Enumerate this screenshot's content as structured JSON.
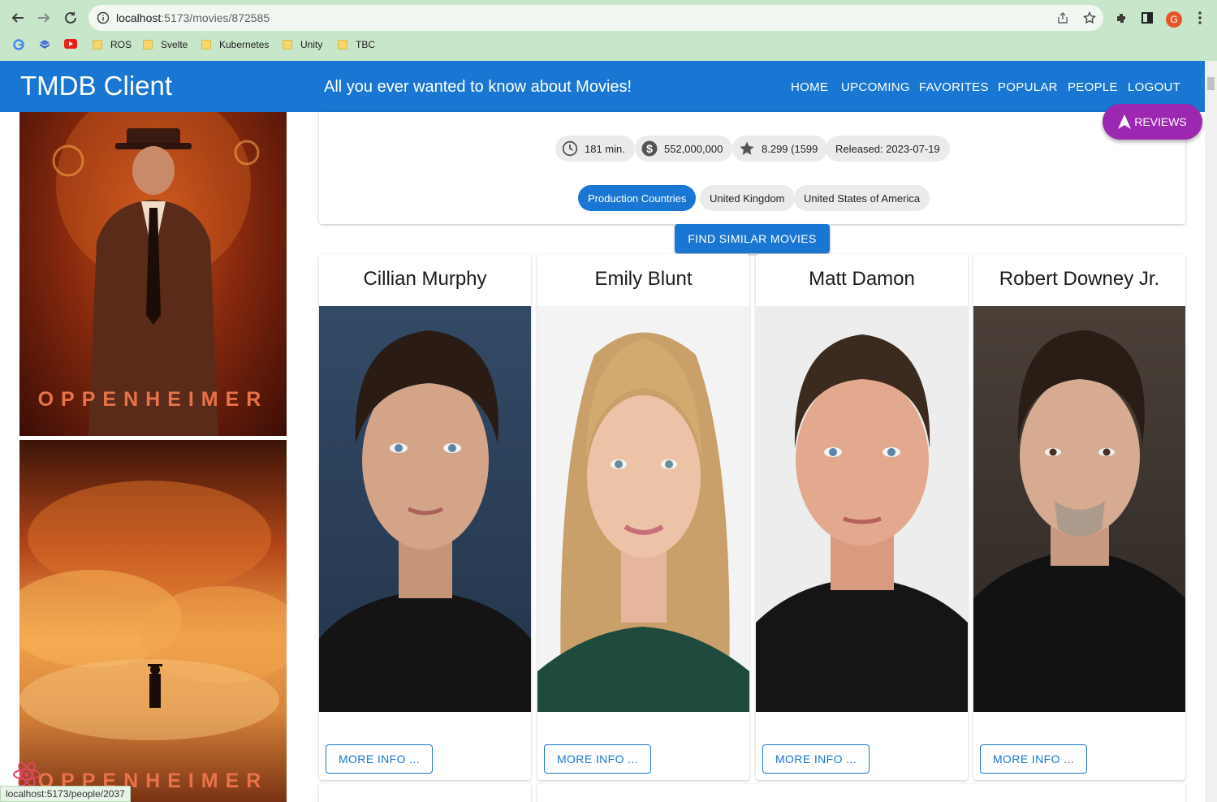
{
  "browser": {
    "url_host": "localhost",
    "url_path": ":5173/movies/872585",
    "profile_initial": "G",
    "bookmarks": [
      "ROS",
      "Svelte",
      "Kubernetes",
      "Unity",
      "TBC"
    ]
  },
  "header": {
    "brand": "TMDB Client",
    "tagline": "All you ever wanted to know about Movies!",
    "nav": [
      "HOME",
      "UPCOMING",
      "FAVORITES",
      "POPULAR",
      "PEOPLE",
      "LOGOUT"
    ]
  },
  "posters": [
    {
      "title": "OPPENHEIMER"
    },
    {
      "title": "OPPENHEIMER"
    }
  ],
  "movie": {
    "runtime": "181 min.",
    "revenue": "552,000,000",
    "rating": "8.299 (1599",
    "released": "Released: 2023-07-19",
    "countries_label": "Production Countries",
    "countries": [
      "United Kingdom",
      "United States of America"
    ]
  },
  "actions": {
    "reviews": "REVIEWS",
    "find_similar": "FIND SIMILAR MOVIES",
    "more_info": "MORE INFO ..."
  },
  "cast": [
    {
      "name": "Cillian Murphy"
    },
    {
      "name": "Emily Blunt"
    },
    {
      "name": "Matt Damon"
    },
    {
      "name": "Robert Downey Jr."
    }
  ],
  "status_bar": "localhost:5173/people/2037",
  "colors": {
    "primary": "#1976d2",
    "fab": "#9c27b0",
    "chrome": "#c8e6c9"
  }
}
